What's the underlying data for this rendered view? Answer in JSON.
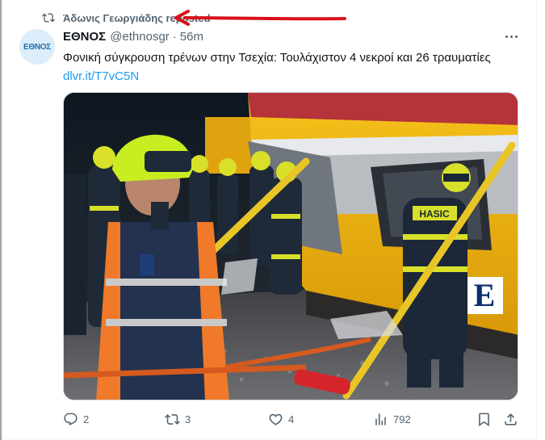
{
  "repost": {
    "icon": "repost-icon",
    "text": "Άδωνις Γεωργιάδης reposted"
  },
  "tweet": {
    "author_name": "ΕΘΝΟΣ",
    "handle": "@ethnosgr",
    "separator": "·",
    "time": "56m",
    "avatar_text": "ΕΘΝΟΣ",
    "text": "Φονική σύγκρουση τρένων στην Τσεχία: Τουλάχιστον 4 νεκροί και 26 τραυματίες",
    "link": "dlvr.it/T7vC5N",
    "media_logo": "E",
    "media_labels": {
      "hasic": "HASIC"
    }
  },
  "actions": {
    "replies": "2",
    "reposts": "3",
    "likes": "4",
    "views": "792"
  },
  "colors": {
    "text_primary": "#0f1419",
    "text_secondary": "#536471",
    "link": "#1d9bf0",
    "annotation_arrow": "#d9111b"
  }
}
